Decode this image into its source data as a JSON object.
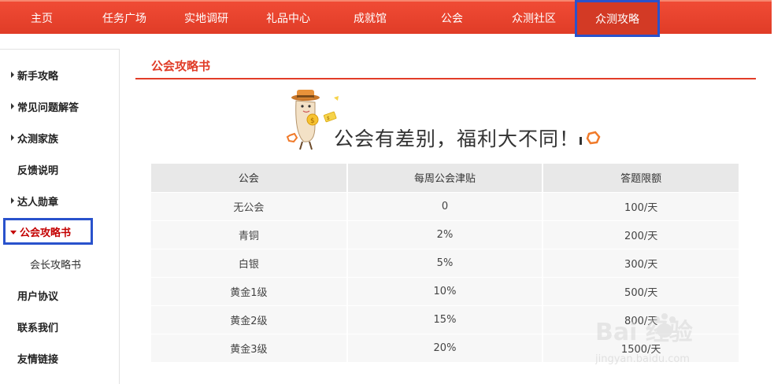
{
  "topnav": {
    "items": [
      {
        "label": "主页",
        "active": false
      },
      {
        "label": "任务广场",
        "active": false
      },
      {
        "label": "实地调研",
        "active": false
      },
      {
        "label": "礼品中心",
        "active": false
      },
      {
        "label": "成就馆",
        "active": false
      },
      {
        "label": "公会",
        "active": false
      },
      {
        "label": "众测社区",
        "active": false
      },
      {
        "label": "众测攻略",
        "active": true
      }
    ]
  },
  "sidebar": {
    "items": [
      {
        "label": "新手攻略",
        "arrow": "right"
      },
      {
        "label": "常见问题解答",
        "arrow": "right"
      },
      {
        "label": "众测家族",
        "arrow": "right"
      },
      {
        "label": "反馈说明",
        "arrow": "none"
      },
      {
        "label": "达人勋章",
        "arrow": "right"
      },
      {
        "label": "公会攻略书",
        "arrow": "down",
        "active": true
      },
      {
        "label": "会长攻略书",
        "arrow": "sub"
      },
      {
        "label": "用户协议",
        "arrow": "none"
      },
      {
        "label": "联系我们",
        "arrow": "none"
      },
      {
        "label": "友情链接",
        "arrow": "none"
      }
    ]
  },
  "main": {
    "section_title": "公会攻略书",
    "banner_text": "公会有差别，福利大不同！",
    "table": {
      "headers": [
        "公会",
        "每周公会津贴",
        "答题限额"
      ],
      "rows": [
        [
          "无公会",
          "0",
          "100/天"
        ],
        [
          "青铜",
          "2%",
          "200/天"
        ],
        [
          "白银",
          "5%",
          "300/天"
        ],
        [
          "黄金1级",
          "10%",
          "500/天"
        ],
        [
          "黄金2级",
          "15%",
          "800/天"
        ],
        [
          "黄金3级",
          "20%",
          "1500/天"
        ]
      ]
    }
  },
  "watermark": {
    "brand": "Bai 经验",
    "url": "jingyan.baidu.com"
  },
  "colors": {
    "nav_red": "#e03c27",
    "highlight_blue": "#2952cc",
    "active_text_red": "#c40000"
  }
}
